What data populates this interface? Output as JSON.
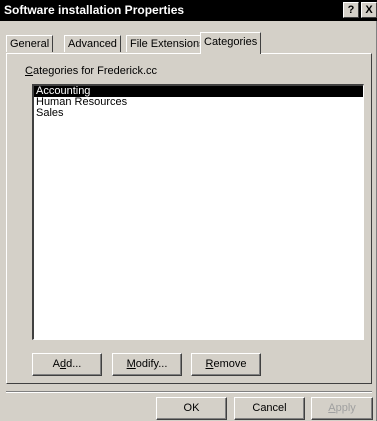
{
  "window": {
    "title": "Software installation Properties",
    "help_glyph": "?",
    "close_glyph": "X"
  },
  "tabs": [
    {
      "label": "General"
    },
    {
      "label": "Advanced"
    },
    {
      "label": "File Extensions"
    },
    {
      "label": "Categories",
      "active": true
    }
  ],
  "categories": {
    "label_prefix": "C",
    "label_rest": "ategories for Frederick.cc",
    "items": [
      "Accounting",
      "Human Resources",
      "Sales"
    ],
    "selected_index": 0
  },
  "panel_buttons": {
    "add_pre": "A",
    "add_u": "d",
    "add_post": "d...",
    "modify_u": "M",
    "modify_post": "odify...",
    "remove_u": "R",
    "remove_post": "emove"
  },
  "footer_buttons": {
    "ok": "OK",
    "cancel": "Cancel",
    "apply_u": "A",
    "apply_post": "pply",
    "apply_enabled": false
  }
}
